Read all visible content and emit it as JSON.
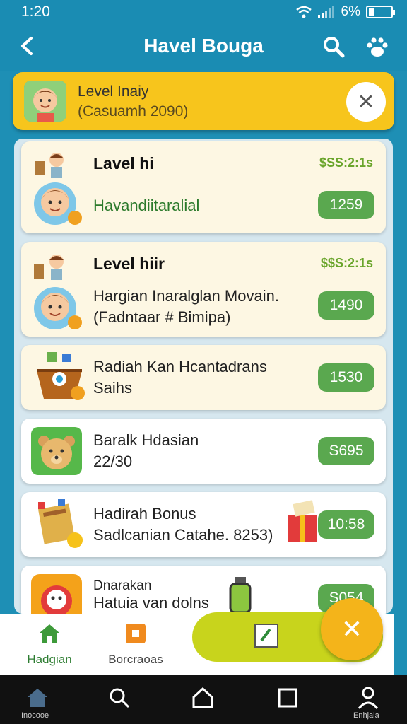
{
  "status": {
    "time": "1:20",
    "battery": "6%"
  },
  "app": {
    "title": "Havel Bouga"
  },
  "banner": {
    "title": "Level Inaiy",
    "subtitle": "(Casuamh 2090)"
  },
  "cards": [
    {
      "title": "Lavel hi",
      "line1": "Havandiitaralial",
      "price": "$SS:2:1s",
      "pill": "1259"
    },
    {
      "title": "Level hiir",
      "line1": "Hargian Inaralglan Movain.",
      "line2": "(Fadntaar # Bimipa)",
      "price": "$$S:2:1s",
      "pill": "1490"
    },
    {
      "line1": "Radiah Kan Hcantadrans",
      "line2": "Saihs",
      "pill": "1530"
    },
    {
      "line1": "Baralk Hdasian",
      "line2": "22/30",
      "pill": "S695"
    },
    {
      "line1": "Hadirah Bonus",
      "line2": "Sadlcanian Catahe. 8253)",
      "pill": "10:58"
    },
    {
      "line1": "Dnarakan",
      "line2": "Hatuia van dolns",
      "pill": "S054"
    }
  ],
  "bottom_nav": {
    "tab1": "Hadgian",
    "tab2": "Borcraoas"
  },
  "sys_nav": {
    "left": "Inocooe",
    "right": "Enhjala"
  },
  "colors": {
    "header": "#1a8cb3",
    "banner": "#f7c51c",
    "pill": "#5aa84f",
    "fab": "#f4b41a",
    "fab_bar": "#c8d41c"
  }
}
